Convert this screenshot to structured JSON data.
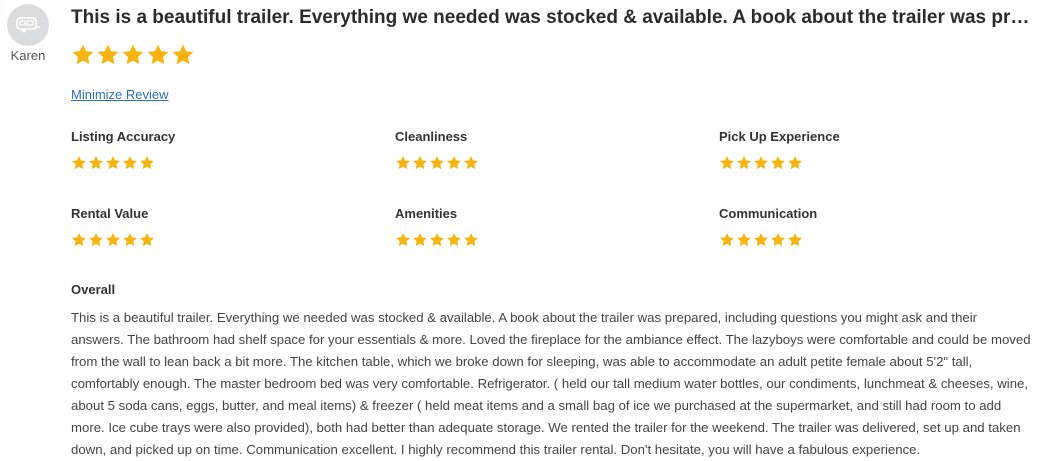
{
  "reviewer": {
    "name": "Karen",
    "avatar_icon": "trailer-icon"
  },
  "review": {
    "title": "This is a beautiful trailer. Everything we needed was stocked & available. A book about the trailer was prepared, including questions you might ask and their answers.",
    "rating": 5,
    "minimize_label": "Minimize Review"
  },
  "categories": [
    {
      "label": "Listing Accuracy",
      "rating": 5
    },
    {
      "label": "Cleanliness",
      "rating": 5
    },
    {
      "label": "Pick Up Experience",
      "rating": 5
    },
    {
      "label": "Rental Value",
      "rating": 5
    },
    {
      "label": "Amenities",
      "rating": 5
    },
    {
      "label": "Communication",
      "rating": 5
    }
  ],
  "overall": {
    "label": "Overall",
    "text": "This is a beautiful trailer. Everything we needed was stocked & available. A book about the trailer was prepared, including questions you might ask and their answers. The bathroom had shelf space for your essentials & more. Loved the fireplace for the ambiance effect. The lazyboys were comfortable and could be moved from the wall to lean back a bit more. The kitchen table, which we broke down for sleeping, was able to accommodate an adult petite female about 5'2\" tall, comfortably enough. The master bedroom bed was very comfortable. Refrigerator. ( held our tall medium water bottles, our condiments, lunchmeat & cheeses, wine, about 5 soda cans, eggs, butter, and meal items) & freezer ( held meat items and a small bag of ice we purchased at the supermarket, and still had room to add more. Ice cube trays were also provided), both had better than adequate storage. We rented the trailer for the weekend. The trailer was delivered, set up and taken down, and picked up on time. Communication excellent. I highly recommend this trailer rental. Don't hesitate, you will have a fabulous experience."
  },
  "colors": {
    "star": "#f5b40f",
    "link": "#2f6fb0",
    "avatar_bg": "#d9dcdf"
  }
}
